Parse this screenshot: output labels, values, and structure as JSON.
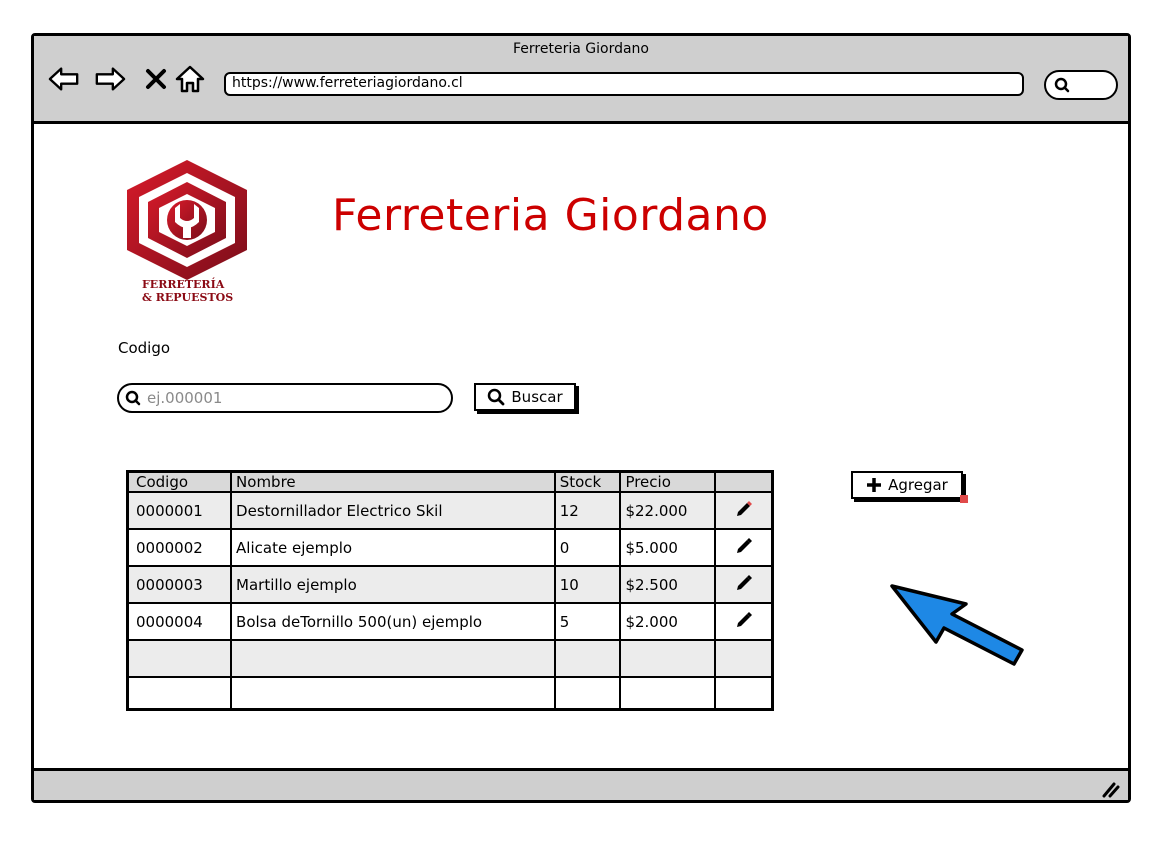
{
  "window": {
    "title": "Ferreteria Giordano",
    "url": "https://www.ferreteriagiordano.cl"
  },
  "brand": {
    "logo_line1": "FERRETERÍA",
    "logo_line2": "& REPUESTOS",
    "page_title": "Ferreteria Giordano",
    "title_color": "#cc0000"
  },
  "search": {
    "label": "Codigo",
    "placeholder": "ej.000001",
    "button_label": "Buscar"
  },
  "actions": {
    "add_label": "Agregar"
  },
  "table": {
    "headers": [
      "Codigo",
      "Nombre",
      "Stock",
      "Precio",
      ""
    ],
    "rows": [
      [
        "0000001",
        "Destornillador Electrico Skil",
        "12",
        "$22.000"
      ],
      [
        "0000002",
        "Alicate ejemplo",
        "0",
        "$5.000"
      ],
      [
        "0000003",
        "Martillo ejemplo",
        "10",
        "$2.500"
      ],
      [
        "0000004",
        "Bolsa deTornillo 500(un) ejemplo",
        "5",
        "$2.000"
      ],
      [
        "",
        "",
        "",
        ""
      ],
      [
        "",
        "",
        "",
        ""
      ]
    ]
  },
  "icons": {
    "back": "back-arrow-icon",
    "forward": "forward-arrow-icon",
    "stop": "close-icon",
    "home": "home-icon",
    "search": "search-icon",
    "edit": "pencil-icon",
    "add": "plus-icon",
    "pointer": "cursor-arrow-icon"
  },
  "colors": {
    "accent_blue": "#1e88e5",
    "brand_red": "#b3121f"
  }
}
